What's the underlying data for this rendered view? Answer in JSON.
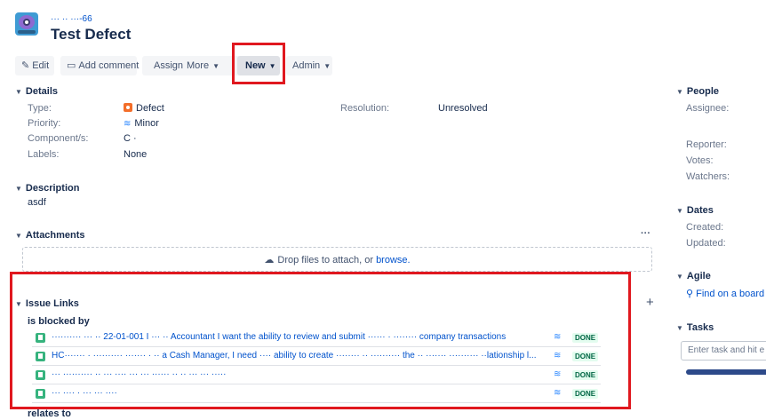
{
  "header": {
    "breadcrumb": "··· ·· ···-66",
    "title": "Test Defect"
  },
  "toolbar": {
    "edit": "Edit",
    "add_comment": "Add comment",
    "assign": "Assign",
    "more": "More",
    "new": "New",
    "admin": "Admin"
  },
  "details": {
    "heading": "Details",
    "type_label": "Type:",
    "type_value": "Defect",
    "priority_label": "Priority:",
    "priority_value": "Minor",
    "component_label": "Component/s:",
    "component_value": "C ·",
    "labels_label": "Labels:",
    "labels_value": "None",
    "resolution_label": "Resolution:",
    "resolution_value": "Unresolved"
  },
  "description": {
    "heading": "Description",
    "text": "asdf"
  },
  "attachments": {
    "heading": "Attachments",
    "more": "···",
    "drop_text": "Drop files to attach, or",
    "browse": "browse."
  },
  "issue_links": {
    "heading": "Issue Links",
    "add": "+",
    "group_blocked": "is blocked by",
    "group_relates": "relates to",
    "rows": [
      {
        "text": "··········  ··· ··  22-01-001 I ··· ·· Accountant I want the ability to review and submit ······ · ········ company transactions",
        "status": "DONE"
      },
      {
        "text": "HC······· · ·········· ·······  · ·· a Cash Manager, I need ···· ability to create ········ ·· ·········· the ·· ······· ·········· ··lationship l...",
        "status": "DONE"
      },
      {
        "text": "··· ·········· ·· ··· ···· ··· ··· ······ ·· ·· ··· ··· ·····",
        "status": "DONE"
      },
      {
        "text": "··· ···· · ··· ··· ····",
        "status": "DONE"
      }
    ]
  },
  "people": {
    "heading": "People",
    "assignee_label": "Assignee:",
    "reporter_label": "Reporter:",
    "votes_label": "Votes:",
    "watchers_label": "Watchers:"
  },
  "dates": {
    "heading": "Dates",
    "created_label": "Created:",
    "updated_label": "Updated:"
  },
  "agile": {
    "heading": "Agile",
    "find_board": "Find on a board"
  },
  "tasks": {
    "heading": "Tasks",
    "placeholder": "Enter task and hit e"
  },
  "colors": {
    "link": "#0052cc",
    "highlight": "#e0181f",
    "done_bg": "#e3fcef",
    "done_text": "#006644"
  }
}
